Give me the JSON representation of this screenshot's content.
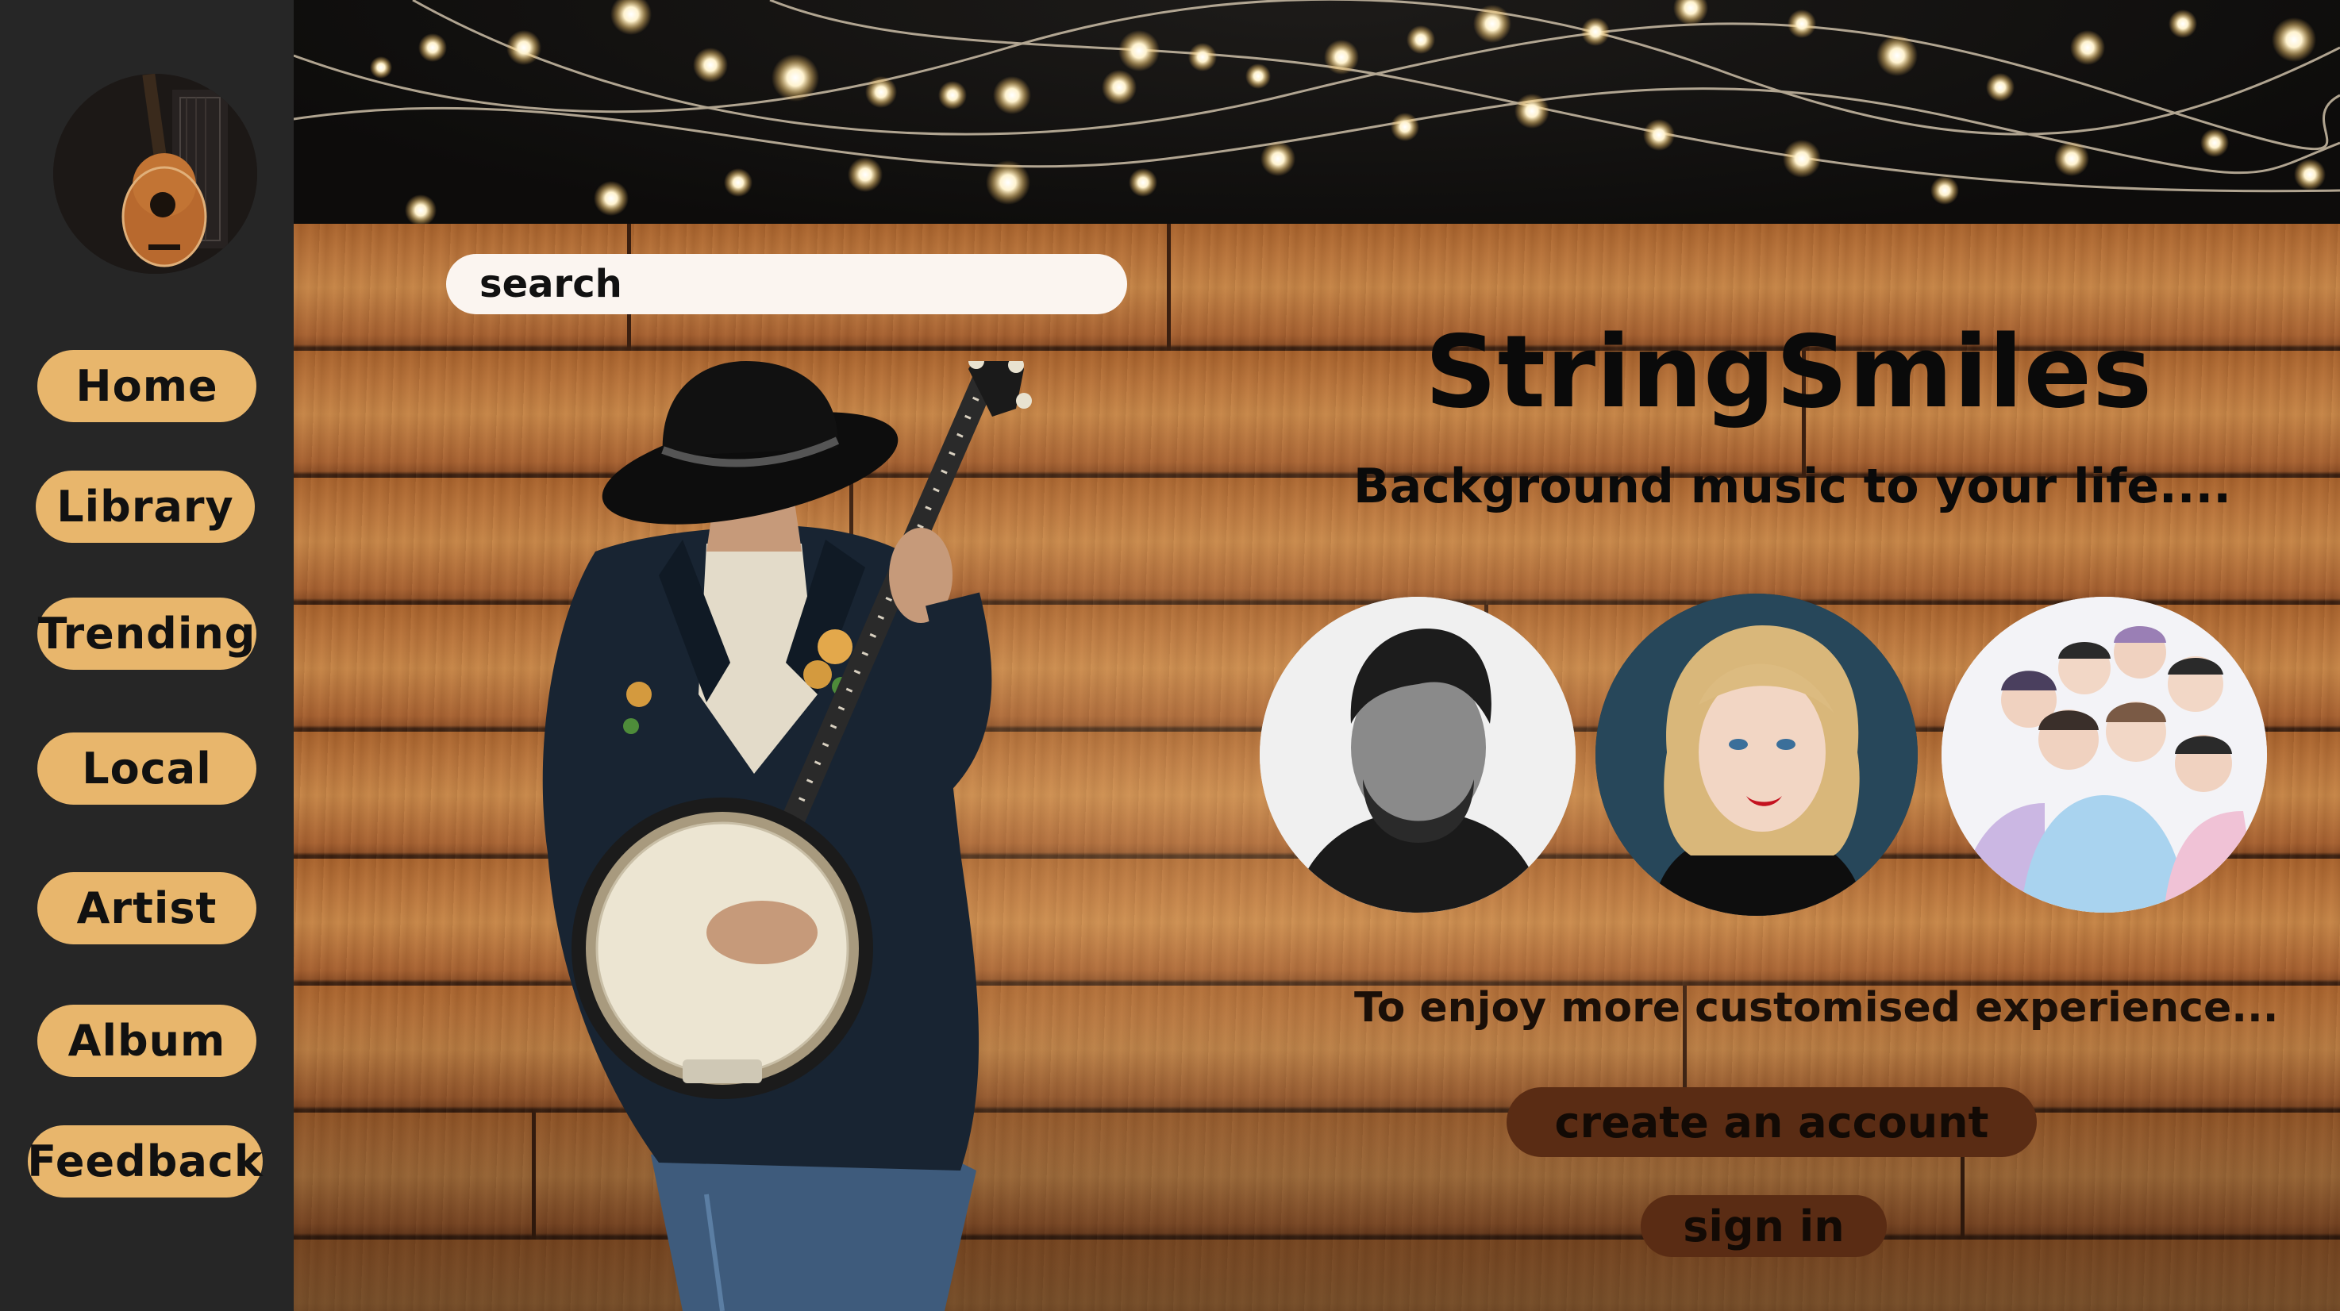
{
  "sidebar": {
    "logo_icon": "guitar-logo-icon",
    "items": [
      {
        "label": "Home"
      },
      {
        "label": "Library"
      },
      {
        "label": "Trending"
      },
      {
        "label": "Local"
      },
      {
        "label": "Artist"
      },
      {
        "label": "Album"
      },
      {
        "label": "Feedback"
      }
    ]
  },
  "search": {
    "placeholder": "search"
  },
  "hero": {
    "title": "StringSmiles",
    "tagline": "Background music to your life....",
    "artists_icons": [
      "male-artist-photo",
      "female-artist-photo",
      "band-photo"
    ]
  },
  "cta": {
    "text": "To enjoy more customised experience...",
    "create_account_label": "create an account",
    "sign_in_label": "sign in"
  },
  "colors": {
    "sidebar_bg": "#262626",
    "nav_button": "#e8b66c",
    "cta_button": "#5a2c14",
    "search_bg": "#fbf5f0"
  }
}
